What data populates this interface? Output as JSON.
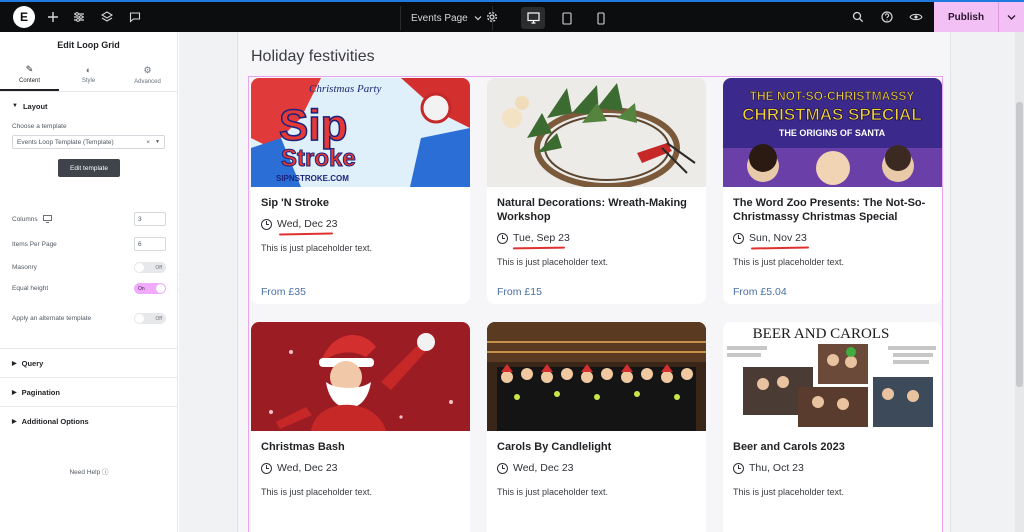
{
  "topbar": {
    "logo_glyph": "E",
    "page_name": "Events Page",
    "publish_label": "Publish"
  },
  "panel": {
    "title": "Edit Loop Grid",
    "tabs": [
      {
        "label": "Content",
        "icon": "pencil-icon"
      },
      {
        "label": "Style",
        "icon": "half-circle-icon"
      },
      {
        "label": "Advanced",
        "icon": "gear-icon"
      }
    ],
    "layout_section": "Layout",
    "choose_template_label": "Choose a template",
    "template_value": "Events Loop Template (Template)",
    "edit_template_label": "Edit template",
    "columns_label": "Columns",
    "columns_value": "3",
    "items_per_page_label": "Items Per Page",
    "items_per_page_value": "6",
    "masonry_label": "Masonry",
    "masonry_state": "Off",
    "equal_height_label": "Equal height",
    "equal_height_state": "On",
    "alternate_template_label": "Apply an alternate template",
    "alternate_template_state": "Off",
    "sections": [
      "Query",
      "Pagination",
      "Additional Options"
    ],
    "need_help": "Need Help"
  },
  "canvas": {
    "heading": "Holiday festivities",
    "cards": [
      {
        "title": "Sip 'N Stroke",
        "date": "Wed, Dec 23",
        "desc": "This is just placeholder text.",
        "price": "From £35",
        "image": "christmas-party-poster"
      },
      {
        "title": "Natural Decorations: Wreath-Making Workshop",
        "date": "Tue, Sep 23",
        "desc": "This is just placeholder text.",
        "price": "From £15",
        "image": "wreath-making-photo"
      },
      {
        "title": "The Word Zoo Presents: The Not-So-Christmassy Christmas Special",
        "date": "Sun, Nov 23",
        "desc": "This is just placeholder text.",
        "price": "From £5.04",
        "image": "not-so-christmassy-poster"
      },
      {
        "title": "Christmas Bash",
        "date": "Wed, Dec 23",
        "desc": "This is just placeholder text.",
        "price": "",
        "image": "santa-photo"
      },
      {
        "title": "Carols By Candlelight",
        "date": "Wed, Dec 23",
        "desc": "This is just placeholder text.",
        "price": "",
        "image": "choir-photo"
      },
      {
        "title": "Beer and Carols 2023",
        "date": "Thu, Oct 23",
        "desc": "This is just placeholder text.",
        "price": "",
        "image": "beer-and-carols-flyer"
      }
    ],
    "poster1": {
      "line1": "Christmas Party",
      "line2": "Sip",
      "line3": "Stroke",
      "line4": "SIPNSTROKE.COM"
    },
    "poster3": {
      "line1": "THE NOT-SO-CHRISTMASSY",
      "line2": "CHRISTMAS SPECIAL",
      "line3": "THE ORIGINS OF SANTA"
    },
    "poster6": {
      "line1": "BEER AND CAROLS"
    }
  },
  "colors": {
    "accent_pink": "#f0abfc",
    "price_blue": "#4a6fa5",
    "annotation_red": "#e03131"
  }
}
